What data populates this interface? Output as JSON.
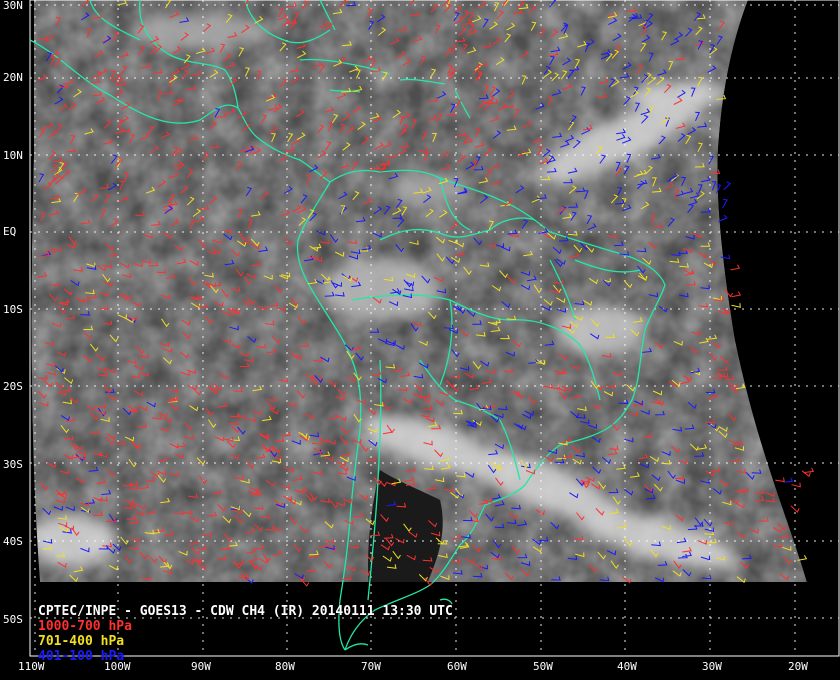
{
  "map": {
    "caption": {
      "title": "CPTEC/INPE - GOES13 - CDW CH4 (IR) 20140111 13:30 UTC",
      "legend": [
        {
          "label": "1000-700 hPa",
          "color": "#ff3030"
        },
        {
          "label": "701-400 hPa",
          "color": "#f0e020"
        },
        {
          "label": "401-100 hPa",
          "color": "#1a1aff"
        }
      ]
    },
    "lat_labels": [
      "30N",
      "20N",
      "10N",
      "EQ",
      "10S",
      "20S",
      "30S",
      "40S",
      "50S"
    ],
    "lon_labels": [
      "110W",
      "100W",
      "90W",
      "80W",
      "70W",
      "60W",
      "50W",
      "40W",
      "30W",
      "20W"
    ],
    "colors": {
      "coastline": "#22e8a8",
      "grid": "#ffffff",
      "background": "#000000",
      "image_gray": "#5a5a5a"
    }
  }
}
